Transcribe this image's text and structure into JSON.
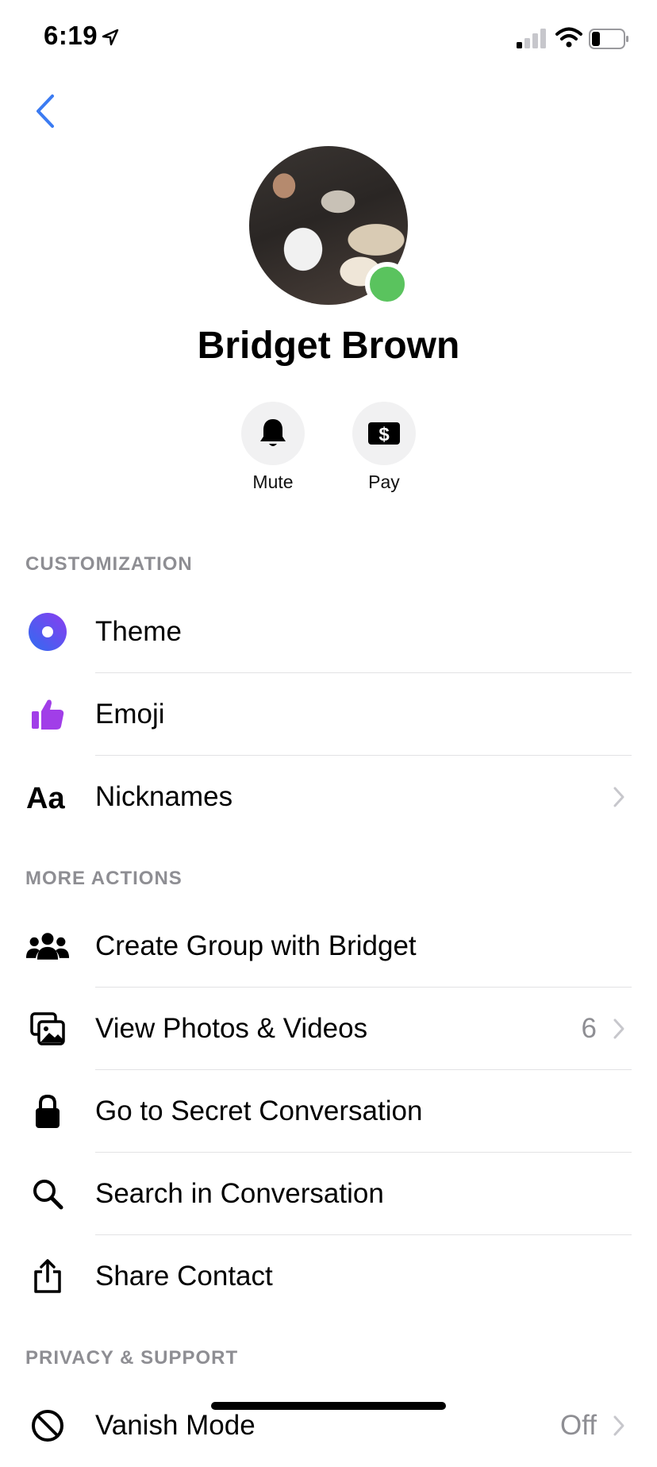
{
  "status_bar": {
    "time": "6:19"
  },
  "profile": {
    "name": "Bridget Brown",
    "online": true
  },
  "actions": [
    {
      "label": "Mute",
      "icon": "bell-icon"
    },
    {
      "label": "Pay",
      "icon": "dollar-icon"
    }
  ],
  "sections": {
    "customization": {
      "header": "CUSTOMIZATION",
      "items": [
        {
          "label": "Theme",
          "icon": "theme-icon"
        },
        {
          "label": "Emoji",
          "icon": "thumbs-up-icon"
        },
        {
          "label": "Nicknames",
          "icon": "text-aa-icon"
        }
      ]
    },
    "more_actions": {
      "header": "MORE ACTIONS",
      "items": [
        {
          "label": "Create Group with Bridget",
          "icon": "group-icon"
        },
        {
          "label": "View Photos & Videos",
          "icon": "photos-icon",
          "value": "6"
        },
        {
          "label": "Go to Secret Conversation",
          "icon": "lock-icon"
        },
        {
          "label": "Search in Conversation",
          "icon": "search-icon"
        },
        {
          "label": "Share Contact",
          "icon": "share-icon"
        }
      ]
    },
    "privacy_support": {
      "header": "PRIVACY & SUPPORT",
      "items": [
        {
          "label": "Vanish Mode",
          "icon": "vanish-mode-icon",
          "value": "Off"
        }
      ]
    }
  },
  "colors": {
    "accent": "#3b7bf2",
    "online": "#5ac35e",
    "theme_purple": "#7a3ff0",
    "emoji_purple": "#a13ee8"
  }
}
